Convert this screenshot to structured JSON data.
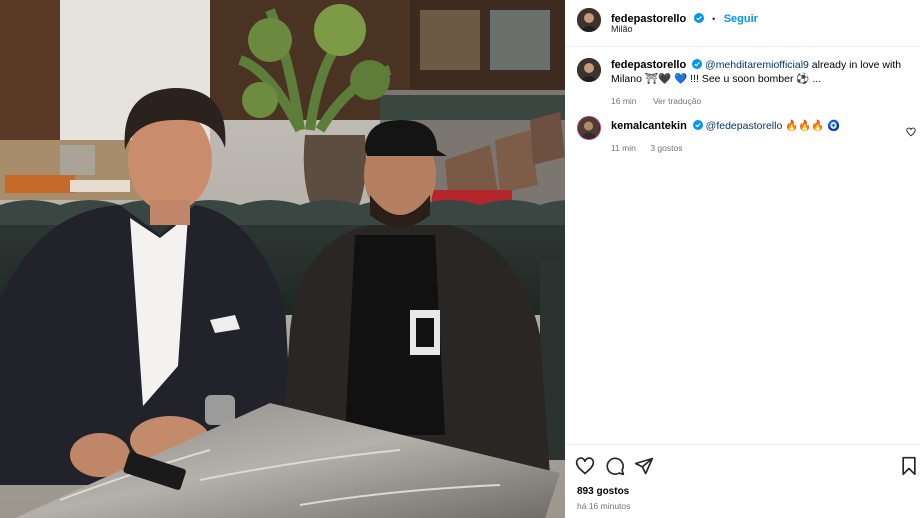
{
  "post": {
    "author": "fedepastorello",
    "follow_label": "Seguir",
    "separator": "•",
    "location": "Milão"
  },
  "caption": {
    "author": "fedepastorello",
    "mention": "@mehditaremiofficial9",
    "text_1": "already in love with",
    "text_2": "Milano",
    "emojis": "⛩🖤 💙 !!! See u soon bomber ⚽ ...",
    "time": "16 min",
    "translate_label": "Ver tradução"
  },
  "comment": {
    "author": "kemalcantekin",
    "mention": "@fedepastorello",
    "emojis": "🔥🔥🔥 🧿",
    "time": "11 min",
    "likes_label": "3 gostos"
  },
  "footer": {
    "likes": "893 gostos",
    "time": "há 16 minutos"
  },
  "icons": {
    "like": "heart-icon",
    "comment": "comment-icon",
    "share": "paper-plane-icon",
    "save": "bookmark-icon",
    "verified": "verified-badge-icon",
    "comment_like": "small-heart-icon"
  },
  "colors": {
    "link": "#0095f6",
    "verified": "#0095f6",
    "mention": "#00376b",
    "muted": "#737373"
  }
}
